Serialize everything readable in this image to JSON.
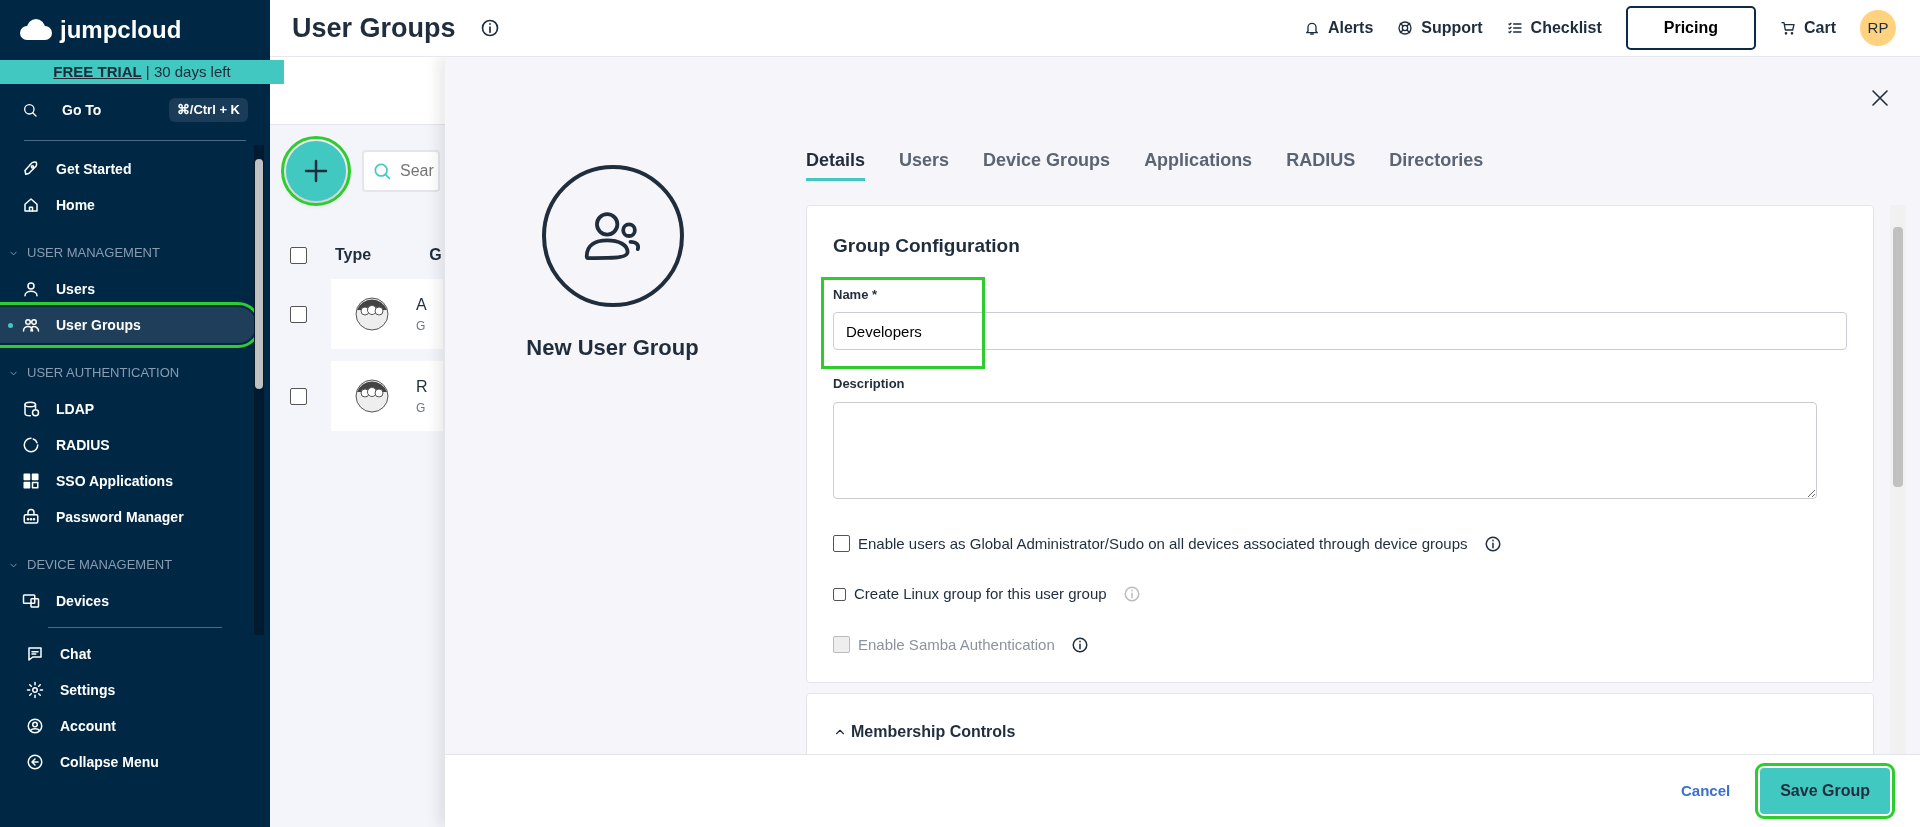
{
  "sidebar": {
    "logo": "jumpcloud",
    "trial": {
      "label": "FREE TRIAL",
      "rest": "| 30 days left"
    },
    "goto": {
      "label": "Go To",
      "shortcut": "⌘/Ctrl + K"
    },
    "nav": [
      {
        "kind": "item",
        "label": "Get Started",
        "selected": false,
        "highlighted": false
      },
      {
        "kind": "item",
        "label": "Home",
        "selected": false,
        "highlighted": false
      },
      {
        "kind": "section",
        "label": "USER MANAGEMENT",
        "expanded": true
      },
      {
        "kind": "item",
        "label": "Users",
        "selected": false,
        "highlighted": false
      },
      {
        "kind": "item",
        "label": "User Groups",
        "selected": true,
        "highlighted": true
      },
      {
        "kind": "section",
        "label": "USER AUTHENTICATION",
        "expanded": true
      },
      {
        "kind": "item",
        "label": "LDAP",
        "selected": false,
        "highlighted": false
      },
      {
        "kind": "item",
        "label": "RADIUS",
        "selected": false,
        "highlighted": false
      },
      {
        "kind": "item",
        "label": "SSO Applications",
        "selected": false,
        "highlighted": false
      },
      {
        "kind": "item",
        "label": "Password Manager",
        "selected": false,
        "highlighted": false
      },
      {
        "kind": "section",
        "label": "DEVICE MANAGEMENT",
        "expanded": true
      },
      {
        "kind": "item",
        "label": "Devices",
        "selected": false,
        "highlighted": false
      }
    ],
    "footer": [
      {
        "label": "Chat"
      },
      {
        "label": "Settings"
      },
      {
        "label": "Account"
      },
      {
        "label": "Collapse Menu"
      }
    ]
  },
  "header": {
    "title": "User Groups",
    "links": [
      {
        "label": "Alerts"
      },
      {
        "label": "Support"
      },
      {
        "label": "Checklist"
      }
    ],
    "pricing": "Pricing",
    "cart": "Cart",
    "avatar": "RP"
  },
  "list_panel": {
    "add_button": {
      "highlighted": true
    },
    "select_all": {
      "checked": false
    },
    "search": {
      "placeholder": "Sear"
    },
    "columns": [
      "Type",
      "G"
    ],
    "rows": [
      {
        "line_1": "A",
        "line_2": "G",
        "checked": false
      },
      {
        "line_1": "R",
        "line_2": "G",
        "checked": false
      }
    ]
  },
  "drawer": {
    "title": "New User Group",
    "tabs": [
      {
        "label": "Details",
        "selected": true
      },
      {
        "label": "Users",
        "selected": false
      },
      {
        "label": "Device Groups",
        "selected": false
      },
      {
        "label": "Applications",
        "selected": false
      },
      {
        "label": "RADIUS",
        "selected": false
      },
      {
        "label": "Directories",
        "selected": false
      }
    ],
    "section_title": "Group Configuration",
    "name": {
      "label": "Name *",
      "value": "Developers",
      "highlighted": true
    },
    "description": {
      "label": "Description"
    },
    "options": [
      {
        "kind": "standard",
        "label": "Enable users as Global Administrator/Sudo on all devices associated through device groups",
        "checked": false,
        "disabled": false
      },
      {
        "kind": "compact",
        "label": "Create Linux group for this user group",
        "checked": false,
        "disabled": false
      },
      {
        "kind": "standard",
        "label": "Enable Samba Authentication",
        "checked": false,
        "disabled": true
      }
    ],
    "membership": {
      "label": "Membership Controls",
      "expanded": true
    },
    "cancel": "Cancel",
    "save": {
      "label": "Save Group",
      "highlighted": true
    }
  }
}
